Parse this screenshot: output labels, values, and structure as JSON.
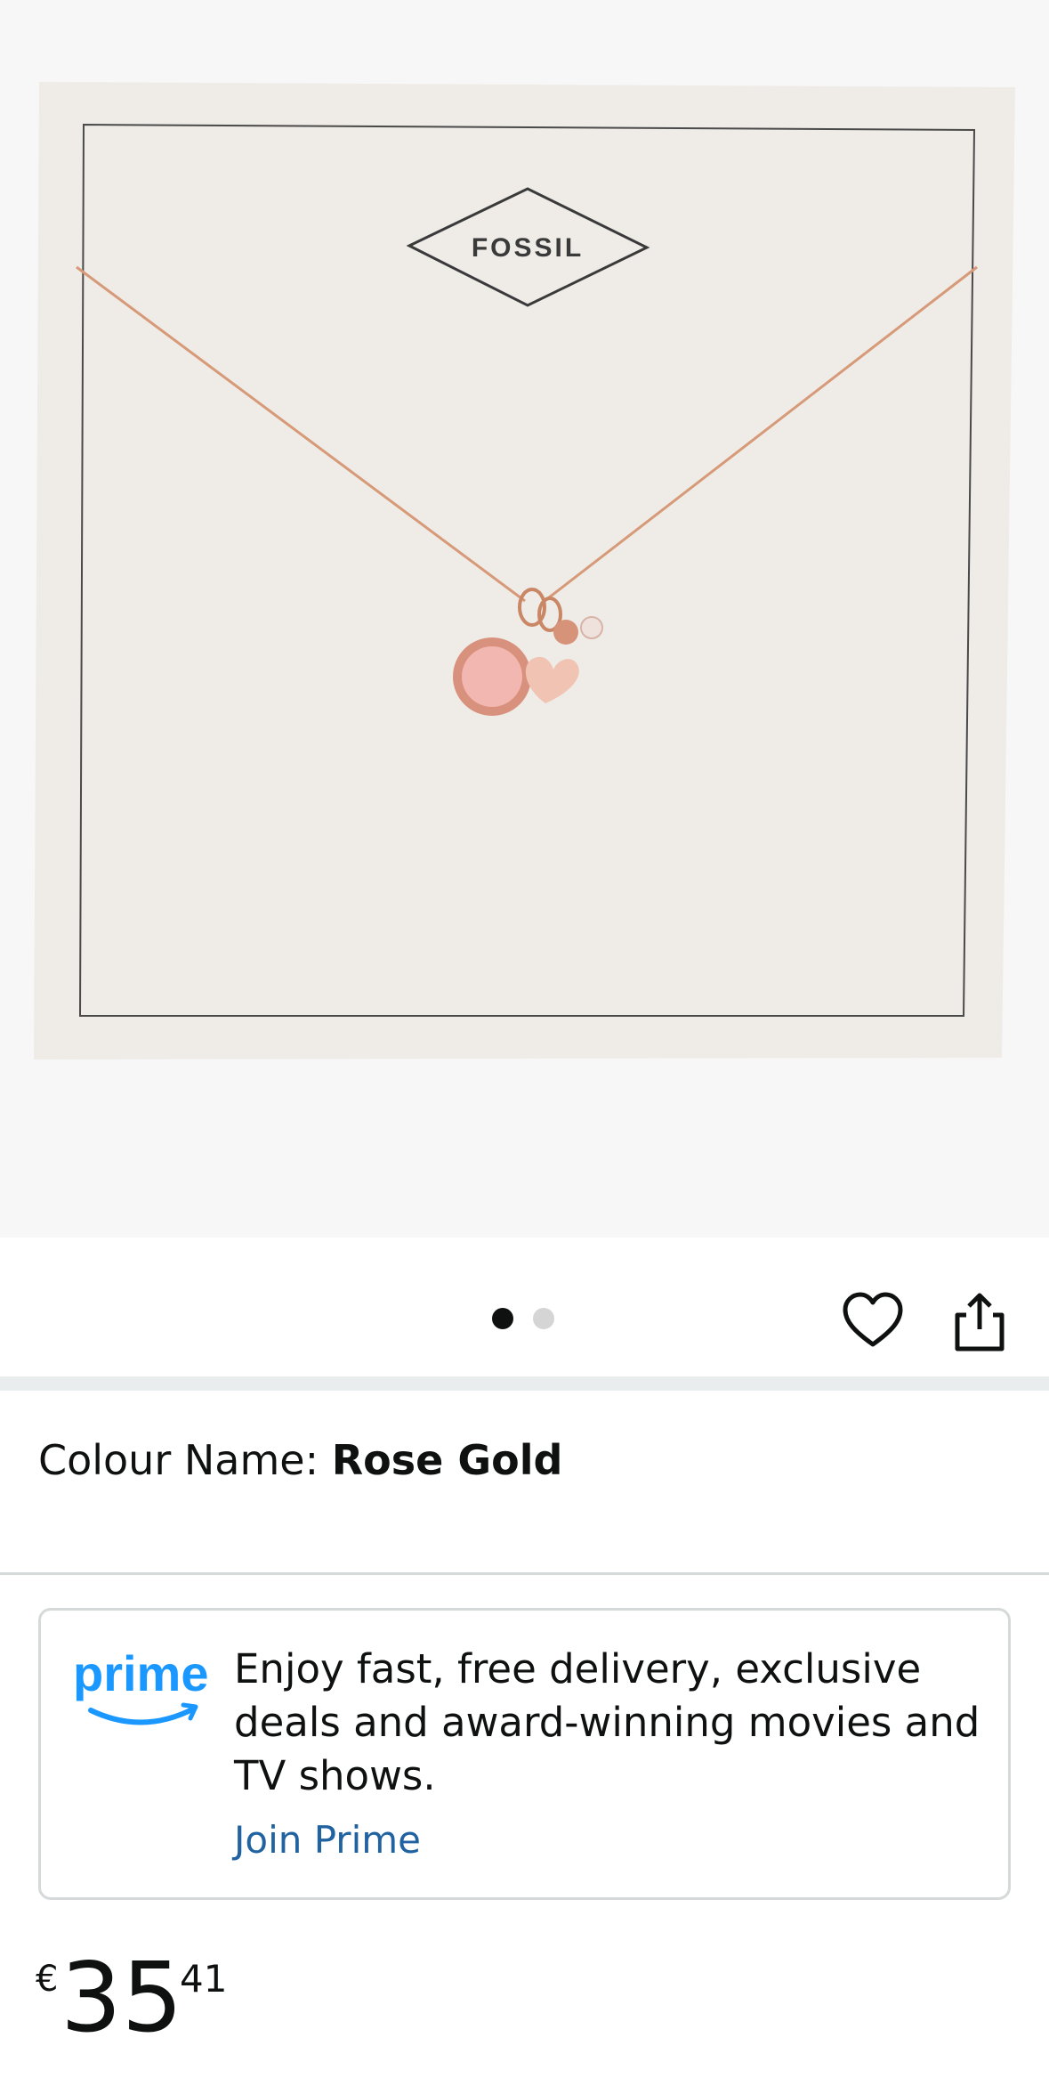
{
  "product_image": {
    "brand_logo_text": "FOSSIL",
    "image_count": 2,
    "active_image_index": 0
  },
  "actions": {
    "wishlist_icon": "heart-outline-icon",
    "share_icon": "share-icon"
  },
  "variant": {
    "label": "Colour Name: ",
    "value": "Rose Gold"
  },
  "prime_banner": {
    "logo_text": "prime",
    "message": "Enjoy fast, free delivery, exclusive deals and award-winning movies and TV shows.",
    "link_label": "Join Prime"
  },
  "price": {
    "currency": "€",
    "whole": "35",
    "fraction": "41"
  },
  "colors": {
    "link": "#2162a1",
    "prime_blue": "#1a98ff",
    "text": "#0f1111",
    "divider": "#d5d9d9"
  }
}
